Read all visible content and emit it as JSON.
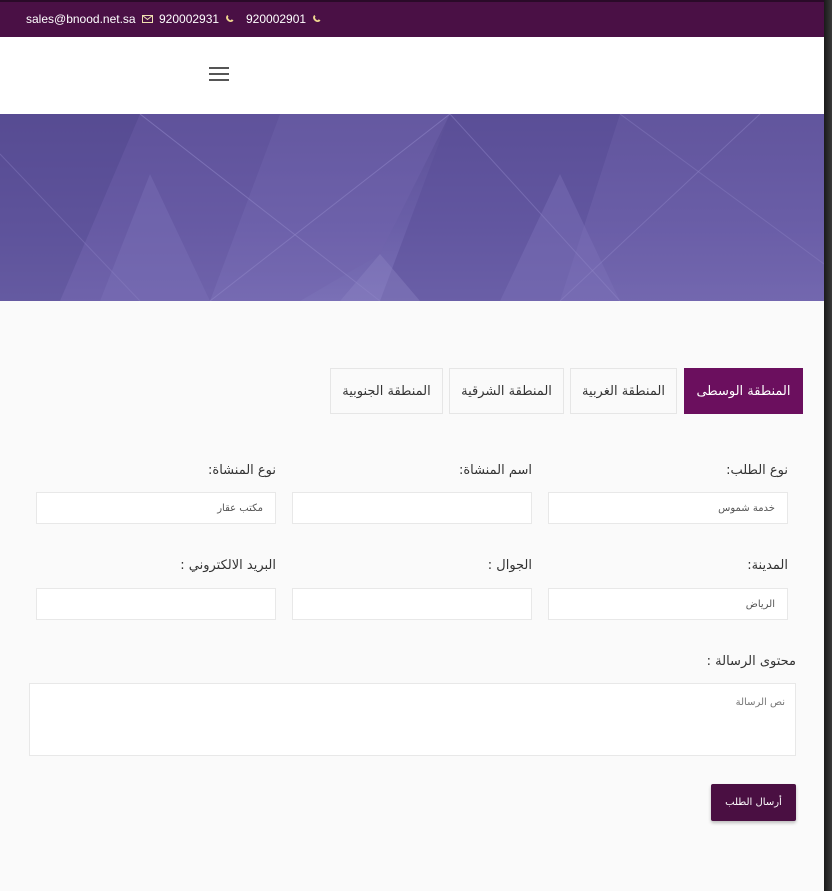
{
  "topbar": {
    "email": "sales@bnood.net.sa",
    "phone1": "920002931",
    "phone2": "920002901"
  },
  "tabs": [
    {
      "label": "المنطقة الوسطى",
      "active": true
    },
    {
      "label": "المنطقة الغربية",
      "active": false
    },
    {
      "label": "المنطقة الشرقية",
      "active": false
    },
    {
      "label": "المنطقة الجنوبية",
      "active": false
    }
  ],
  "form": {
    "request_type_label": "نوع الطلب:",
    "request_type_value": "خدمة شموس",
    "facility_name_label": "اسم المنشاة:",
    "facility_name_value": "",
    "facility_type_label": "نوع المنشاة:",
    "facility_type_value": "مكتب عقار",
    "city_label": "المدينة:",
    "city_value": "الرياض",
    "mobile_label": "الجوال :",
    "mobile_value": "",
    "email_label": "البريد الالكتروني :",
    "email_value": "",
    "message_label": "محتوى الرسالة :",
    "message_placeholder": "نص الرسالة",
    "submit_label": "أرسال الطلب"
  },
  "colors": {
    "topbar": "#4a1045",
    "accent": "#6b0f5e",
    "banner": "#6a5fa8"
  }
}
